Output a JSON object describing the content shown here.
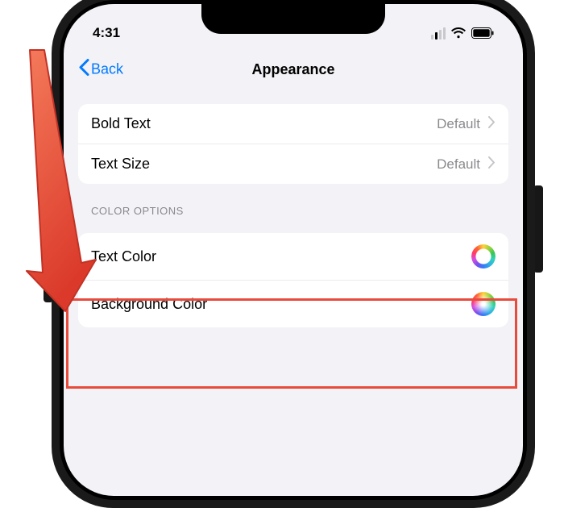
{
  "statusbar": {
    "time": "4:31"
  },
  "nav": {
    "back_label": "Back",
    "title": "Appearance"
  },
  "group_text": {
    "rows": [
      {
        "label": "Bold Text",
        "value": "Default"
      },
      {
        "label": "Text Size",
        "value": "Default"
      }
    ]
  },
  "color_section": {
    "header": "COLOR OPTIONS",
    "rows": [
      {
        "label": "Text Color",
        "swatch": "ring"
      },
      {
        "label": "Background Color",
        "swatch": "solid"
      }
    ]
  },
  "colors": {
    "accent": "#007aff",
    "highlight": "#e84b3c",
    "bg": "#f2f2f7"
  }
}
